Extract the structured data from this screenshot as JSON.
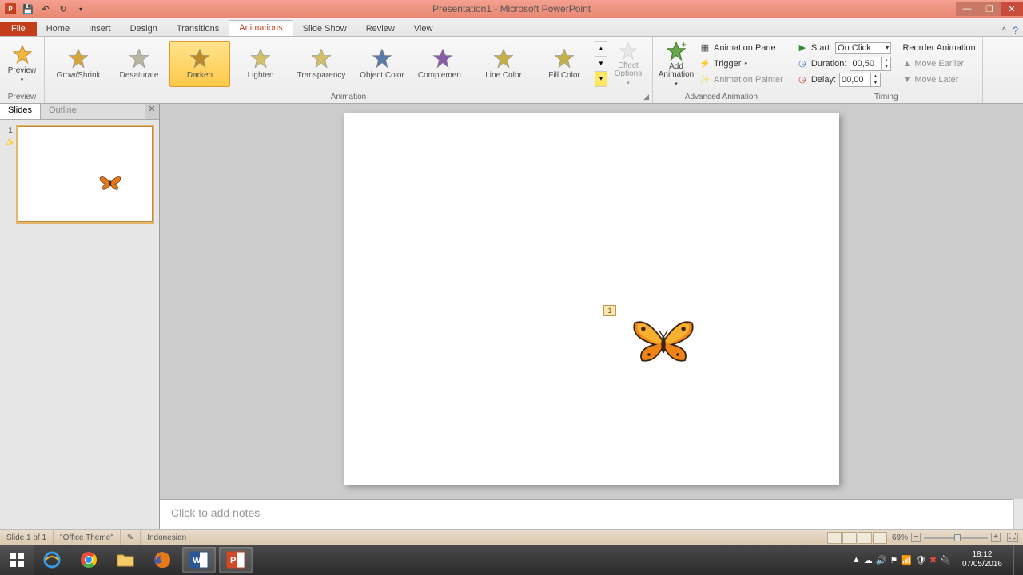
{
  "title": "Presentation1 - Microsoft PowerPoint",
  "tabs": {
    "file": "File",
    "home": "Home",
    "insert": "Insert",
    "design": "Design",
    "transitions": "Transitions",
    "animations": "Animations",
    "slideshow": "Slide Show",
    "review": "Review",
    "view": "View"
  },
  "preview": {
    "button": "Preview",
    "group": "Preview"
  },
  "gallery": {
    "items": [
      {
        "label": "Grow/Shrink",
        "color": "#d4a63a"
      },
      {
        "label": "Desaturate",
        "color": "#b7b7a0"
      },
      {
        "label": "Darken",
        "color": "#b88c2a",
        "selected": true
      },
      {
        "label": "Lighten",
        "color": "#d4c06a"
      },
      {
        "label": "Transparency",
        "color": "#d4c06a"
      },
      {
        "label": "Object Color",
        "color": "#5b7aa8"
      },
      {
        "label": "Complemen...",
        "color": "#8a5ba8"
      },
      {
        "label": "Line Color",
        "color": "#c4b04a"
      },
      {
        "label": "Fill Color",
        "color": "#c4b04a"
      }
    ],
    "group": "Animation"
  },
  "effect_options": "Effect\nOptions",
  "advanced": {
    "add": "Add\nAnimation",
    "pane": "Animation Pane",
    "trigger": "Trigger",
    "painter": "Animation Painter",
    "group": "Advanced Animation"
  },
  "timing": {
    "start_label": "Start:",
    "start_value": "On Click",
    "duration_label": "Duration:",
    "duration_value": "00,50",
    "delay_label": "Delay:",
    "delay_value": "00,00",
    "reorder": "Reorder Animation",
    "earlier": "Move Earlier",
    "later": "Move Later",
    "group": "Timing"
  },
  "sidepanel": {
    "slides": "Slides",
    "outline": "Outline",
    "num": "1"
  },
  "anim_tag": "1",
  "notes": "Click to add notes",
  "status": {
    "slide": "Slide 1 of 1",
    "theme": "\"Office Theme\"",
    "lang": "Indonesian",
    "zoom": "69%"
  },
  "clock": {
    "time": "18:12",
    "date": "07/05/2016"
  }
}
